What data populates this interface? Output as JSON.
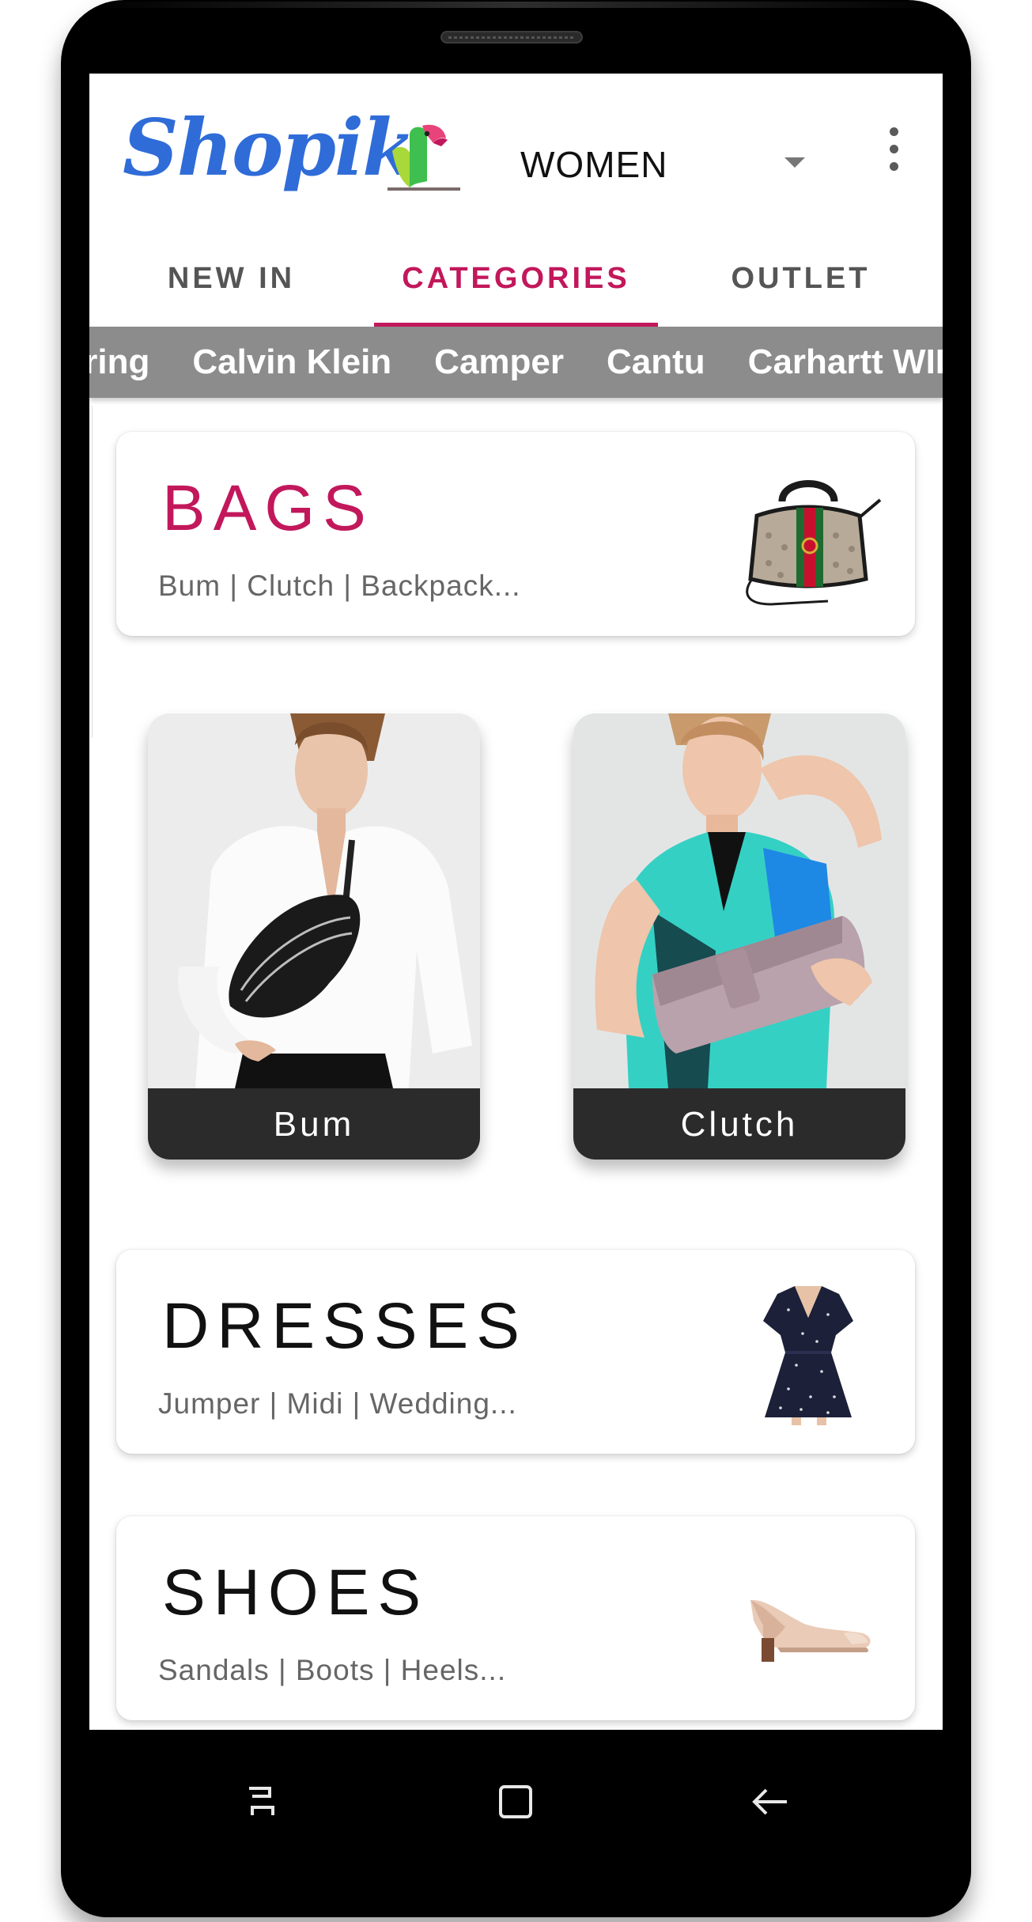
{
  "app": {
    "logo_text": "Shopik",
    "department": "WOMEN"
  },
  "tabs": [
    {
      "label": "NEW IN",
      "active": false
    },
    {
      "label": "CATEGORIES",
      "active": true
    },
    {
      "label": "OUTLET",
      "active": false
    }
  ],
  "brands": [
    "Spring",
    "Calvin Klein",
    "Camper",
    "Cantu",
    "Carhartt WIP"
  ],
  "categories": [
    {
      "title": "BAGS",
      "subtitle": "Bum | Clutch | Backpack...",
      "thumbnail": "handbag-icon"
    },
    {
      "title": "DRESSES",
      "subtitle": "Jumper | Midi | Wedding...",
      "thumbnail": "dress-icon"
    },
    {
      "title": "SHOES",
      "subtitle": "Sandals | Boots | Heels...",
      "thumbnail": "heel-shoe-icon"
    }
  ],
  "subcategories": [
    {
      "label": "Bum"
    },
    {
      "label": "Clutch"
    }
  ],
  "colors": {
    "accent": "#c2185b",
    "logo": "#2f6cd8",
    "brand_strip": "#8c8c8c",
    "tile_label_bg": "#2b2b2b"
  },
  "navigation": [
    "recent-apps-icon",
    "home-icon",
    "back-icon"
  ]
}
